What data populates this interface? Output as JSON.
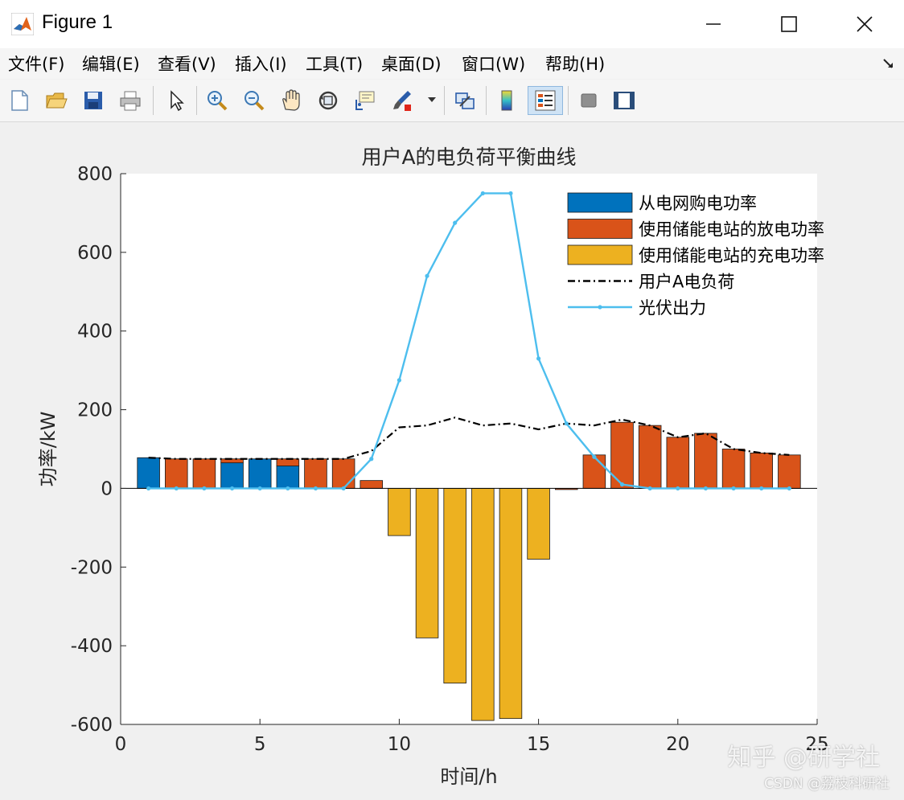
{
  "window": {
    "title": "Figure 1"
  },
  "menu": {
    "items": [
      "文件(F)",
      "编辑(E)",
      "查看(V)",
      "插入(I)",
      "工具(T)",
      "桌面(D)",
      "窗口(W)",
      "帮助(H)"
    ]
  },
  "toolbar": {
    "icons": [
      "new-figure-icon",
      "open-file-icon",
      "save-icon",
      "print-icon",
      "select-arrow-icon",
      "zoom-in-icon",
      "zoom-out-icon",
      "pan-hand-icon",
      "rotate-3d-icon",
      "data-cursor-icon",
      "brush-icon",
      "link-plot-icon",
      "colorbar-icon",
      "legend-icon",
      "hide-plot-tools-icon",
      "show-plot-tools-icon"
    ]
  },
  "watermark": {
    "zhihu": "知乎 @研学社",
    "csdn": "CSDN @荔枝科研社"
  },
  "chart_data": {
    "type": "bar",
    "title": "用户A的电负荷平衡曲线",
    "xlabel": "时间/h",
    "ylabel": "功率/kW",
    "xlim": [
      0,
      25
    ],
    "ylim": [
      -600,
      800
    ],
    "xticks": [
      0,
      5,
      10,
      15,
      20,
      25
    ],
    "yticks": [
      -600,
      -400,
      -200,
      0,
      200,
      400,
      600,
      800
    ],
    "grid": false,
    "legend_position": "top-right",
    "x": [
      1,
      2,
      3,
      4,
      5,
      6,
      7,
      8,
      9,
      10,
      11,
      12,
      13,
      14,
      15,
      16,
      17,
      18,
      19,
      20,
      21,
      22,
      23,
      24
    ],
    "bar_series": [
      {
        "name": "从电网购电功率",
        "color": "#0072bd",
        "values": [
          78,
          0,
          0,
          65,
          75,
          57,
          0,
          0,
          0,
          0,
          0,
          0,
          0,
          0,
          0,
          0,
          0,
          0,
          0,
          0,
          0,
          0,
          0,
          0
        ]
      },
      {
        "name": "使用储能电站的放电功率",
        "color": "#d95319",
        "values": [
          0,
          75,
          75,
          10,
          0,
          18,
          75,
          75,
          20,
          0,
          0,
          0,
          0,
          0,
          0,
          -3,
          85,
          168,
          160,
          130,
          140,
          100,
          90,
          85
        ]
      },
      {
        "name": "使用储能电站的充电功率",
        "color": "#edb120",
        "values": [
          0,
          0,
          0,
          0,
          0,
          0,
          0,
          0,
          0,
          -120,
          -380,
          -495,
          -590,
          -585,
          -180,
          0,
          0,
          0,
          0,
          0,
          0,
          0,
          0,
          0
        ]
      }
    ],
    "line_series": [
      {
        "name": "用户A电负荷",
        "color": "#000000",
        "style": "dash-dot",
        "values": [
          78,
          75,
          75,
          75,
          75,
          75,
          75,
          75,
          95,
          155,
          160,
          180,
          160,
          165,
          150,
          165,
          160,
          175,
          160,
          130,
          140,
          100,
          90,
          85
        ]
      },
      {
        "name": "光伏出力",
        "color": "#4dbeee",
        "style": "solid-dot-markers",
        "values": [
          0,
          0,
          0,
          0,
          0,
          0,
          0,
          0,
          75,
          275,
          540,
          675,
          750,
          750,
          330,
          165,
          80,
          10,
          0,
          0,
          0,
          0,
          0,
          0
        ]
      }
    ]
  }
}
